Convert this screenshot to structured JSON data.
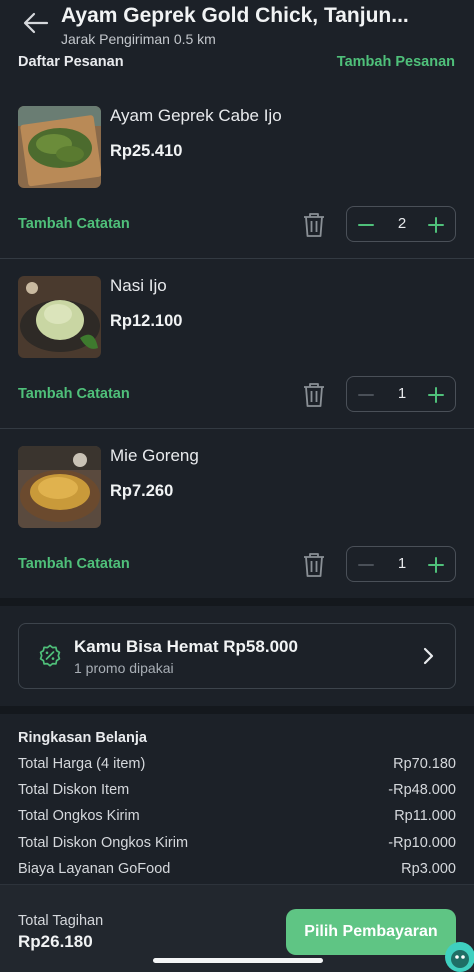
{
  "header": {
    "title": "Ayam Geprek Gold Chick, Tanjun...",
    "subtitle": "Jarak Pengiriman 0.5 km",
    "back_icon": "arrow-left-icon"
  },
  "order_list": {
    "heading": "Daftar Pesanan",
    "add_label": "Tambah Pesanan",
    "items": [
      {
        "name": "Ayam Geprek Cabe Ijo",
        "price": "Rp25.410",
        "note_label": "Tambah Catatan",
        "qty": "2"
      },
      {
        "name": "Nasi Ijo",
        "price": "Rp12.100",
        "note_label": "Tambah Catatan",
        "qty": "1"
      },
      {
        "name": "Mie Goreng",
        "price": "Rp7.260",
        "note_label": "Tambah Catatan",
        "qty": "1"
      }
    ]
  },
  "promo": {
    "title": "Kamu Bisa Hemat Rp58.000",
    "subtitle": "1 promo dipakai"
  },
  "summary": {
    "heading": "Ringkasan Belanja",
    "rows": [
      {
        "label": "Total Harga (4 item)",
        "value": "Rp70.180"
      },
      {
        "label": "Total Diskon Item",
        "value": "-Rp48.000"
      },
      {
        "label": "Total Ongkos Kirim",
        "value": "Rp11.000"
      },
      {
        "label": "Total Diskon Ongkos Kirim",
        "value": "-Rp10.000"
      },
      {
        "label": "Biaya Layanan GoFood",
        "value": "Rp3.000"
      }
    ]
  },
  "footer": {
    "total_label": "Total Tagihan",
    "total_value": "Rp26.180",
    "pay_label": "Pilih Pembayaran"
  },
  "colors": {
    "background": "#1c2128",
    "accent_green": "#4fc07a",
    "button_green": "#5fc584"
  }
}
